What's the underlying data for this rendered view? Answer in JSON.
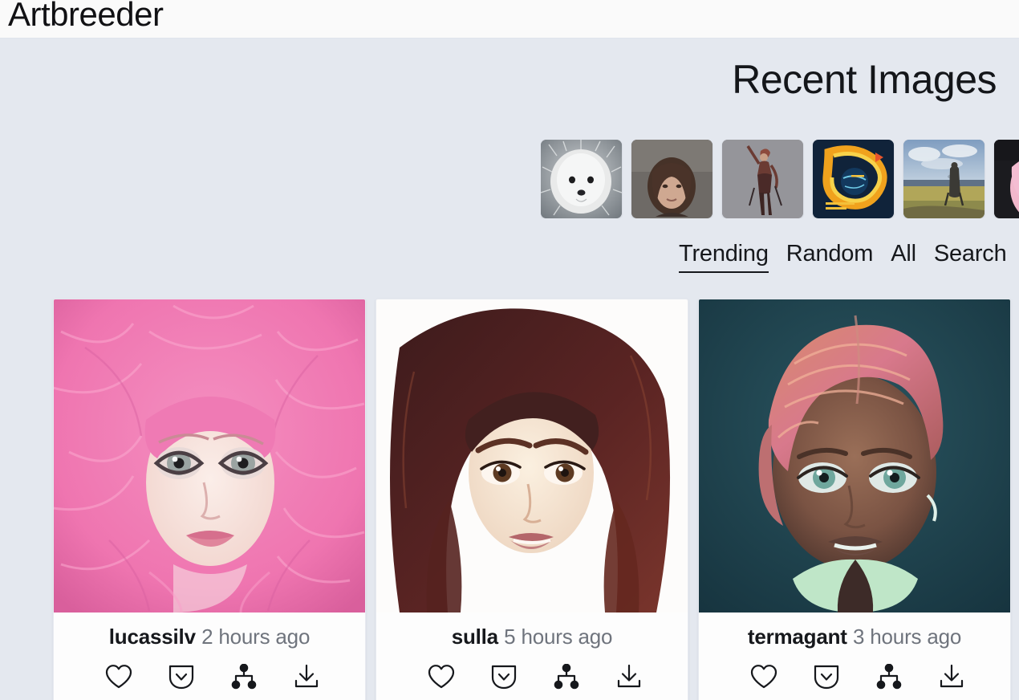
{
  "header": {
    "brand": "Artbreeder"
  },
  "main": {
    "section_title": "Recent Images",
    "tabs": [
      {
        "label": "Trending",
        "active": true
      },
      {
        "label": "Random",
        "active": false
      },
      {
        "label": "All",
        "active": false
      },
      {
        "label": "Search",
        "active": false
      }
    ],
    "thumbnails": [
      {
        "name": "thumbnail-white-dog",
        "alt": "white fluffy dog portrait"
      },
      {
        "name": "thumbnail-woman-portrait",
        "alt": "brown haired woman portrait"
      },
      {
        "name": "thumbnail-fantasy-warrior",
        "alt": "fantasy warrior figure on gray"
      },
      {
        "name": "thumbnail-orange-abstract",
        "alt": "orange and yellow abstract artwork"
      },
      {
        "name": "thumbnail-landscape-figure",
        "alt": "landscape with standing figure"
      },
      {
        "name": "thumbnail-pink-hair-anime",
        "alt": "pink haired anime character"
      }
    ],
    "cards": [
      {
        "author": "lucassilv",
        "time": "2 hours ago",
        "image_alt": "woman with voluminous pink hair and large gray eyes",
        "actions": [
          {
            "name": "like-icon",
            "label": "Like"
          },
          {
            "name": "save-icon",
            "label": "Save"
          },
          {
            "name": "lineage-tree-icon",
            "label": "Lineage"
          },
          {
            "name": "download-icon",
            "label": "Download"
          }
        ]
      },
      {
        "author": "sulla",
        "time": "5 hours ago",
        "image_alt": "woman with dark auburn hair and brown eyes on white background",
        "actions": [
          {
            "name": "like-icon",
            "label": "Like"
          },
          {
            "name": "save-icon",
            "label": "Save"
          },
          {
            "name": "lineage-tree-icon",
            "label": "Lineage"
          },
          {
            "name": "download-icon",
            "label": "Download"
          }
        ]
      },
      {
        "author": "termagant",
        "time": "3 hours ago",
        "image_alt": "dark skinned woman with short copper pink hair and teal eyes",
        "actions": [
          {
            "name": "like-icon",
            "label": "Like"
          },
          {
            "name": "save-icon",
            "label": "Save"
          },
          {
            "name": "lineage-tree-icon",
            "label": "Lineage"
          },
          {
            "name": "download-icon",
            "label": "Download"
          }
        ]
      }
    ]
  },
  "colors": {
    "page_background": "#e4e8ef",
    "header_background": "#fafafa",
    "card_background": "#fdfdfd",
    "text_primary": "#16181c",
    "text_muted": "#6f747d"
  }
}
